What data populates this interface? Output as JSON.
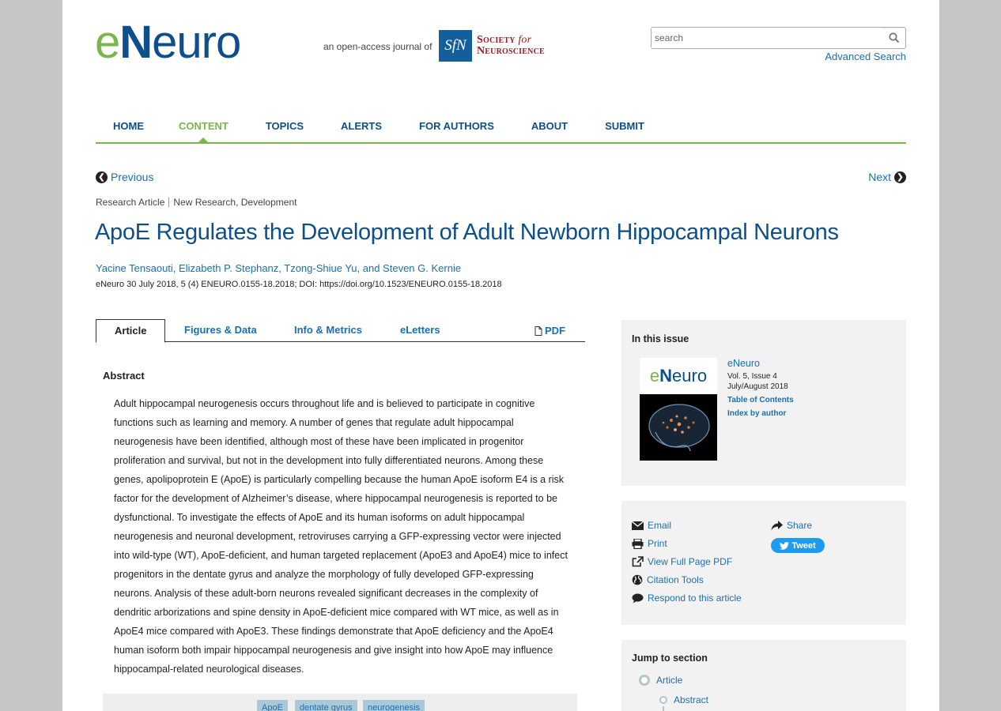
{
  "header": {
    "logo": {
      "e": "e",
      "n": "N",
      "rest": "euro"
    },
    "open_access_text": "an open-access journal of",
    "sfn_logo": "SfN",
    "society_line1_a": "Society",
    "society_line1_b": "for",
    "society_line2": "Neuroscience",
    "search_placeholder": "search",
    "advanced_search": "Advanced Search"
  },
  "nav": {
    "items": [
      {
        "label": "HOME"
      },
      {
        "label": "CONTENT"
      },
      {
        "label": "TOPICS"
      },
      {
        "label": "ALERTS"
      },
      {
        "label": "FOR AUTHORS"
      },
      {
        "label": "ABOUT"
      },
      {
        "label": "SUBMIT"
      }
    ],
    "active": "CONTENT"
  },
  "pager": {
    "previous": "Previous",
    "next": "Next"
  },
  "breadcrumb": {
    "type": "Research Article",
    "section": "New Research, Development"
  },
  "article": {
    "title": "ApoE Regulates the Development of Adult Newborn Hippocampal Neurons",
    "authors": "Yacine Tensaouti, Elizabeth P. Stephanz, Tzong-Shiue Yu, and Steven G. Kernie",
    "citation": "eNeuro 30 July 2018, 5 (4) ENEURO.0155-18.2018; DOI: https://doi.org/10.1523/ENEURO.0155-18.2018"
  },
  "tabs": {
    "article": "Article",
    "figures": "Figures & Data",
    "info": "Info & Metrics",
    "eletters": "eLetters",
    "pdf": "PDF"
  },
  "abstract": {
    "heading": "Abstract",
    "text": "Adult hippocampal neurogenesis occurs throughout life and is believed to participate in cognitive functions such as learning and memory. A number of genes that regulate adult hippocampal neurogenesis have been identified, although most of these have been implicated in progenitor proliferation and survival, but not in the development into fully differentiated neurons. Among these genes, apolipoprotein E (ApoE) is particularly compelling because the human ApoE isoform E4 is a risk factor for the development of Alzheimer’s disease, where hippocampal neurogenesis is reported to be dysfunctional. To investigate the effects of ApoE and its human isoforms on adult hippocampal neurogenesis and neuronal development, retroviruses carrying a GFP-expressing vector were injected into wild-type (WT), ApoE-deficient, and human targeted replacement (ApoE3 and ApoE4) mice to infect progenitors in the dentate gyrus and analyze the morphology of fully developed GFP-expressing neurons. Analysis of these adult-born neurons revealed significant decreases in the complexity of dendritic arborizations and spine density in ApoE-deficient mice compared with WT mice, as well as in ApoE4 mice compared with ApoE3. These findings demonstrate that ApoE deficiency and the ApoE4 human isoform both impair hippocampal neurogenesis and give insight into how ApoE may influence hippocampal-related neurological diseases."
  },
  "keywords": [
    "ApoE",
    "dentate gyrus",
    "neurogenesis"
  ],
  "issue": {
    "heading": "In this issue",
    "journal": "eNeuro",
    "volume": "Vol. 5, Issue 4",
    "date": "July/August 2018",
    "toc": "Table of Contents",
    "index": "Index by author"
  },
  "share": {
    "email": "Email",
    "print": "Print",
    "view_pdf": "View Full Page PDF",
    "citation_tools": "Citation Tools",
    "respond": "Respond to this article",
    "share": "Share",
    "tweet": "Tweet"
  },
  "jump": {
    "heading": "Jump to section",
    "items": [
      "Article",
      "Abstract"
    ]
  },
  "colors": {
    "brand_green": "#7ab648",
    "brand_blue": "#0d4f8b",
    "link": "#1a6fb3",
    "sfn_red": "#9b1b1e"
  }
}
